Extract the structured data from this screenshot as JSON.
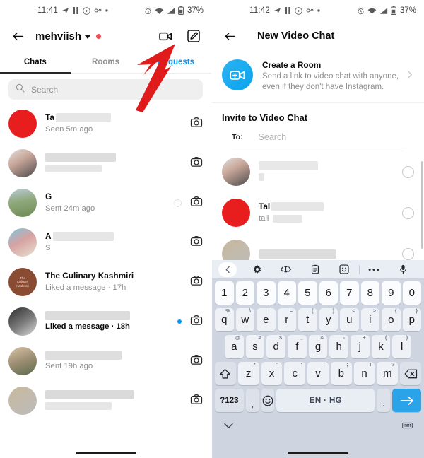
{
  "left": {
    "status": {
      "time": "11:41",
      "battery": "37%",
      "icons": [
        "send-icon",
        "pause-icon",
        "play-circle-icon",
        "vpn-key-icon",
        "dot-icon",
        "alarm-icon",
        "wifi-icon",
        "signal-icon",
        "battery-icon"
      ]
    },
    "header": {
      "username": "mehviish",
      "back": "back-arrow-icon",
      "video_icon": "video-camera-icon",
      "compose_icon": "compose-icon"
    },
    "tabs": [
      {
        "label": "Chats",
        "active": true
      },
      {
        "label": "Rooms",
        "active": false
      },
      {
        "label": "Requests",
        "active": false
      }
    ],
    "search": {
      "placeholder": "Search",
      "icon": "search-icon"
    },
    "chats": [
      {
        "name": "Ta",
        "sub": "Seen 5m ago",
        "avatar": "red",
        "bold": false,
        "unread": false,
        "pending": false
      },
      {
        "name": "",
        "sub": "",
        "avatar": "photo2",
        "bold": false,
        "unread": false,
        "pending": false
      },
      {
        "name": "G",
        "sub": "Sent 24m ago",
        "avatar": "photo1",
        "bold": false,
        "unread": false,
        "pending": true
      },
      {
        "name": "A",
        "sub": "S",
        "avatar": "photo5",
        "bold": false,
        "unread": false,
        "pending": false
      },
      {
        "name": "The Culinary Kashmiri",
        "sub": "Liked a message · 17h",
        "avatar": "brown",
        "bold": false,
        "unread": false,
        "pending": false
      },
      {
        "name": "",
        "sub": "Liked a message · 18h",
        "avatar": "photo3",
        "bold": true,
        "unread": true,
        "pending": false
      },
      {
        "name": "",
        "sub": "Sent 19h ago",
        "avatar": "photo4",
        "bold": false,
        "unread": false,
        "pending": false
      },
      {
        "name": "",
        "sub": "",
        "avatar": "photo6",
        "bold": false,
        "unread": false,
        "pending": false
      }
    ],
    "row_action_icon": "camera-icon",
    "annotation": {
      "arrow": "red-arrow-pointing-to-video-icon",
      "color": "#e01b1b"
    }
  },
  "right": {
    "status": {
      "time": "11:42",
      "battery": "37%"
    },
    "header": {
      "title": "New Video Chat",
      "back": "back-arrow-icon"
    },
    "create_room": {
      "title": "Create a Room",
      "description": "Send a link to video chat with anyone, even if they don't have Instagram.",
      "icon": "video-plus-icon",
      "chevron": "chevron-right-icon",
      "accent": "#0aa3ef"
    },
    "invite": {
      "section_title": "Invite to Video Chat",
      "to_label": "To:",
      "to_placeholder": "Search",
      "people": [
        {
          "name": "",
          "sub": "",
          "avatar": "photo2",
          "selected": false
        },
        {
          "name": "Tal",
          "sub": "tali",
          "avatar": "red",
          "selected": false
        },
        {
          "name": "",
          "sub": "",
          "avatar": "photo6",
          "selected": false
        }
      ]
    },
    "keyboard": {
      "toolbar": [
        "chevron-left-icon",
        "gear-icon",
        "cursor-move-icon",
        "clipboard-icon",
        "sticker-icon",
        "more-dots-icon",
        "microphone-icon"
      ],
      "row_numbers": [
        {
          "k": "1",
          "s": ""
        },
        {
          "k": "2",
          "s": ""
        },
        {
          "k": "3",
          "s": ""
        },
        {
          "k": "4",
          "s": ""
        },
        {
          "k": "5",
          "s": ""
        },
        {
          "k": "6",
          "s": ""
        },
        {
          "k": "7",
          "s": ""
        },
        {
          "k": "8",
          "s": ""
        },
        {
          "k": "9",
          "s": ""
        },
        {
          "k": "0",
          "s": ""
        }
      ],
      "row1": [
        {
          "k": "q",
          "s": "%"
        },
        {
          "k": "w",
          "s": "\\"
        },
        {
          "k": "e",
          "s": "|"
        },
        {
          "k": "r",
          "s": "="
        },
        {
          "k": "t",
          "s": "["
        },
        {
          "k": "y",
          "s": "]"
        },
        {
          "k": "u",
          "s": "<"
        },
        {
          "k": "i",
          "s": ">"
        },
        {
          "k": "o",
          "s": "{"
        },
        {
          "k": "p",
          "s": "}"
        }
      ],
      "row2": [
        {
          "k": "a",
          "s": "@"
        },
        {
          "k": "s",
          "s": "#"
        },
        {
          "k": "d",
          "s": "$"
        },
        {
          "k": "f",
          "s": "_"
        },
        {
          "k": "g",
          "s": "&"
        },
        {
          "k": "h",
          "s": "-"
        },
        {
          "k": "j",
          "s": "+"
        },
        {
          "k": "k",
          "s": "("
        },
        {
          "k": "l",
          "s": ")"
        }
      ],
      "row3": [
        {
          "k": "z",
          "s": "*"
        },
        {
          "k": "x",
          "s": "\""
        },
        {
          "k": "c",
          "s": "'"
        },
        {
          "k": "v",
          "s": ":"
        },
        {
          "k": "b",
          "s": ";"
        },
        {
          "k": "n",
          "s": "!"
        },
        {
          "k": "m",
          "s": "?"
        }
      ],
      "shift_icon": "shift-icon",
      "backspace_icon": "backspace-icon",
      "symbols_label": "?123",
      "comma_label": ",",
      "emoji_icon": "emoji-icon",
      "space_label": "EN · HG",
      "period_label": ".",
      "enter_icon": "enter-arrow-icon",
      "enter_color": "#2aa3e8",
      "hide_icon": "chevron-down-icon",
      "switch_icon": "keyboard-switch-icon"
    }
  }
}
